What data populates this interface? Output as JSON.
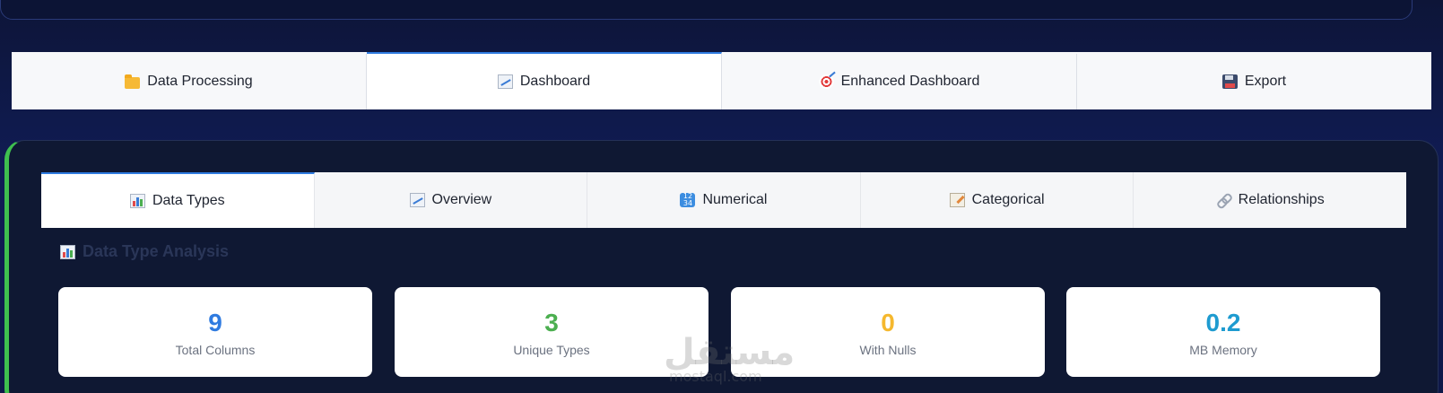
{
  "main_tabs": [
    {
      "label": "Data Processing",
      "icon": "folder-icon"
    },
    {
      "label": "Dashboard",
      "icon": "chart-up-icon",
      "active": true
    },
    {
      "label": "Enhanced Dashboard",
      "icon": "target-icon"
    },
    {
      "label": "Export",
      "icon": "floppy-icon"
    }
  ],
  "sub_tabs": [
    {
      "label": "Data Types",
      "icon": "bar-chart-icon",
      "active": true
    },
    {
      "label": "Overview",
      "icon": "chart-up-icon"
    },
    {
      "label": "Numerical",
      "icon": "numbers-icon"
    },
    {
      "label": "Categorical",
      "icon": "memo-icon"
    },
    {
      "label": "Relationships",
      "icon": "link-icon"
    }
  ],
  "section": {
    "title": "Data Type Analysis",
    "icon": "bar-chart-icon"
  },
  "stats": [
    {
      "value": "9",
      "label": "Total Columns",
      "color": "#2f7be0"
    },
    {
      "value": "3",
      "label": "Unique Types",
      "color": "#4caf50"
    },
    {
      "value": "0",
      "label": "With Nulls",
      "color": "#f5b82e"
    },
    {
      "value": "0.2",
      "label": "MB Memory",
      "color": "#1e9bd0"
    }
  ],
  "watermark": {
    "text": "مستقل",
    "sub": "mostaql.com"
  },
  "colors": {
    "accent": "#2f7be0",
    "panel_border": "#3fbf4f"
  }
}
